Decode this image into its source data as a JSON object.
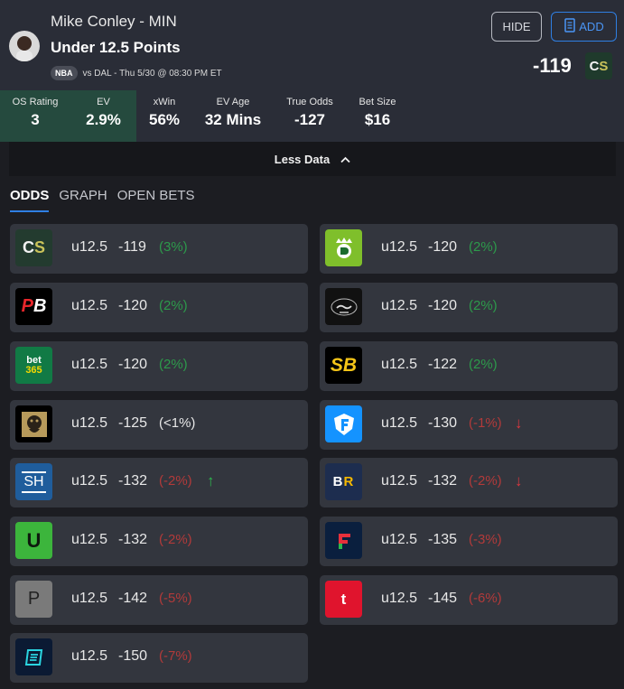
{
  "header": {
    "player_name": "Mike Conley - MIN",
    "prop_line": "Under 12.5 Points",
    "league": "NBA",
    "game_info": "vs DAL - Thu 5/30 @ 08:30 PM ET",
    "hide_label": "HIDE",
    "add_label": "ADD",
    "best_odds": "-119",
    "best_book": "CS"
  },
  "stats": [
    {
      "label": "OS Rating",
      "value": "3"
    },
    {
      "label": "EV",
      "value": "2.9%"
    },
    {
      "label": "xWin",
      "value": "56%"
    },
    {
      "label": "EV Age",
      "value": "32 Mins"
    },
    {
      "label": "True Odds",
      "value": "-127"
    },
    {
      "label": "Bet Size",
      "value": "$16"
    }
  ],
  "less_data_label": "Less Data",
  "tabs": [
    "ODDS",
    "GRAPH",
    "OPEN BETS"
  ],
  "books": [
    {
      "logo": "CS",
      "line": "u12.5",
      "odds": "-119",
      "ev": "(3%)",
      "ev_type": "pos",
      "arrow": ""
    },
    {
      "logo": "DK",
      "line": "u12.5",
      "odds": "-120",
      "ev": "(2%)",
      "ev_type": "pos",
      "arrow": ""
    },
    {
      "logo": "PB",
      "line": "u12.5",
      "odds": "-120",
      "ev": "(2%)",
      "ev_type": "pos",
      "arrow": ""
    },
    {
      "logo": "Hard Rock",
      "line": "u12.5",
      "odds": "-120",
      "ev": "(2%)",
      "ev_type": "pos",
      "arrow": ""
    },
    {
      "logo": "bet365",
      "line": "u12.5",
      "odds": "-120",
      "ev": "(2%)",
      "ev_type": "pos",
      "arrow": ""
    },
    {
      "logo": "SB",
      "line": "u12.5",
      "odds": "-122",
      "ev": "(2%)",
      "ev_type": "pos",
      "arrow": ""
    },
    {
      "logo": "MGM",
      "line": "u12.5",
      "odds": "-125",
      "ev": "(<1%)",
      "ev_type": "neu",
      "arrow": ""
    },
    {
      "logo": "FD",
      "line": "u12.5",
      "odds": "-130",
      "ev": "(-1%)",
      "ev_type": "neg",
      "arrow": "↓"
    },
    {
      "logo": "SH",
      "line": "u12.5",
      "odds": "-132",
      "ev": "(-2%)",
      "ev_type": "neg",
      "arrow": "↑"
    },
    {
      "logo": "BR",
      "line": "u12.5",
      "odds": "-132",
      "ev": "(-2%)",
      "ev_type": "neg",
      "arrow": "↓"
    },
    {
      "logo": "U",
      "line": "u12.5",
      "odds": "-132",
      "ev": "(-2%)",
      "ev_type": "neg",
      "arrow": ""
    },
    {
      "logo": "F",
      "line": "u12.5",
      "odds": "-135",
      "ev": "(-3%)",
      "ev_type": "neg",
      "arrow": ""
    },
    {
      "logo": "P",
      "line": "u12.5",
      "odds": "-142",
      "ev": "(-5%)",
      "ev_type": "neg",
      "arrow": ""
    },
    {
      "logo": "t",
      "line": "u12.5",
      "odds": "-145",
      "ev": "(-6%)",
      "ev_type": "neg",
      "arrow": ""
    },
    {
      "logo": "E",
      "line": "u12.5",
      "odds": "-150",
      "ev": "(-7%)",
      "ev_type": "neg",
      "arrow": ""
    }
  ]
}
